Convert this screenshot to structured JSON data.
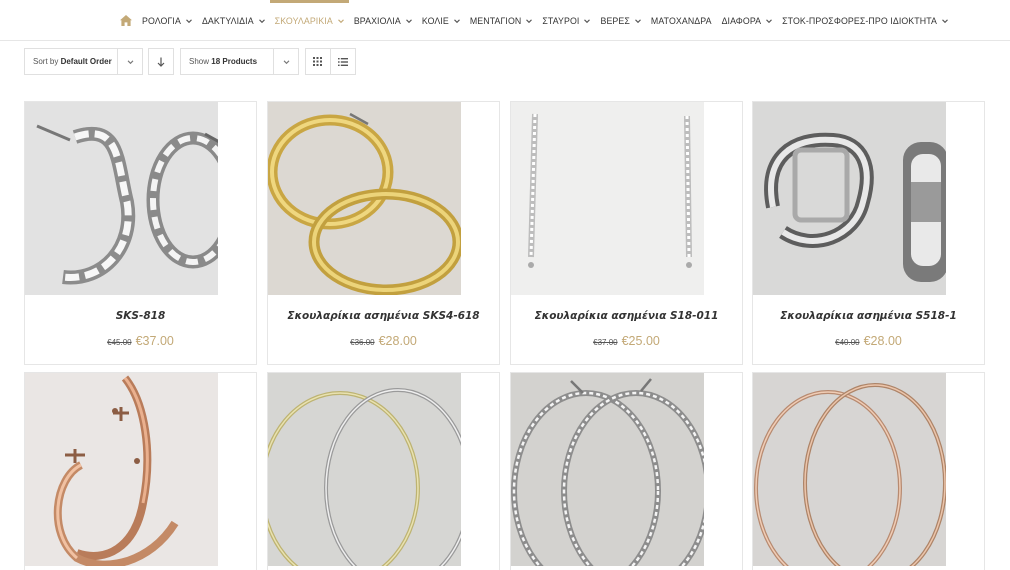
{
  "nav": {
    "items": [
      {
        "label": "ΡΟΛΟΓΙΑ",
        "has_dropdown": true
      },
      {
        "label": "ΔΑΚΤΥΛΙΔΙΑ",
        "has_dropdown": true
      },
      {
        "label": "ΣΚΟΥΛΑΡΙΚΙΑ",
        "has_dropdown": true,
        "active": true
      },
      {
        "label": "ΒΡΑΧΙΟΛΙΑ",
        "has_dropdown": true
      },
      {
        "label": "ΚΟΛΙΕ",
        "has_dropdown": true
      },
      {
        "label": "ΜΕΝΤΑΓΙΟΝ",
        "has_dropdown": true
      },
      {
        "label": "ΣΤΑΥΡΟΙ",
        "has_dropdown": true
      },
      {
        "label": "ΒΕΡΕΣ",
        "has_dropdown": true
      },
      {
        "label": "ΜΑΤΟΧΑΝΔΡΑ",
        "has_dropdown": false
      },
      {
        "label": "ΔΙΑΦΟΡΑ",
        "has_dropdown": true
      },
      {
        "label": "ΣΤΟΚ-ΠΡΟΣΦΟΡΕΣ-ΠΡΟ ΙΔΙΟΚΤΗΤΑ",
        "has_dropdown": true
      }
    ],
    "accent_color": "#c3a977"
  },
  "toolbar": {
    "sort_prefix": "Sort by",
    "sort_value": "Default Order",
    "show_prefix": "Show",
    "show_value": "18 Products"
  },
  "products": [
    {
      "title": "SKS-818",
      "old_price": "€45.00",
      "price": "€37.00"
    },
    {
      "title": "Σκουλαρίκια ασημένια SKS4-618",
      "old_price": "€36.00",
      "price": "€28.00"
    },
    {
      "title": "Σκουλαρίκια ασημένια S18-011",
      "old_price": "€37.00",
      "price": "€25.00"
    },
    {
      "title": "Σκουλαρίκια ασημένια S518-1",
      "old_price": "€40.00",
      "price": "€28.00"
    },
    {
      "title": "",
      "old_price": "",
      "price": ""
    },
    {
      "title": "",
      "old_price": "",
      "price": ""
    },
    {
      "title": "",
      "old_price": "",
      "price": ""
    },
    {
      "title": "",
      "old_price": "",
      "price": ""
    }
  ]
}
